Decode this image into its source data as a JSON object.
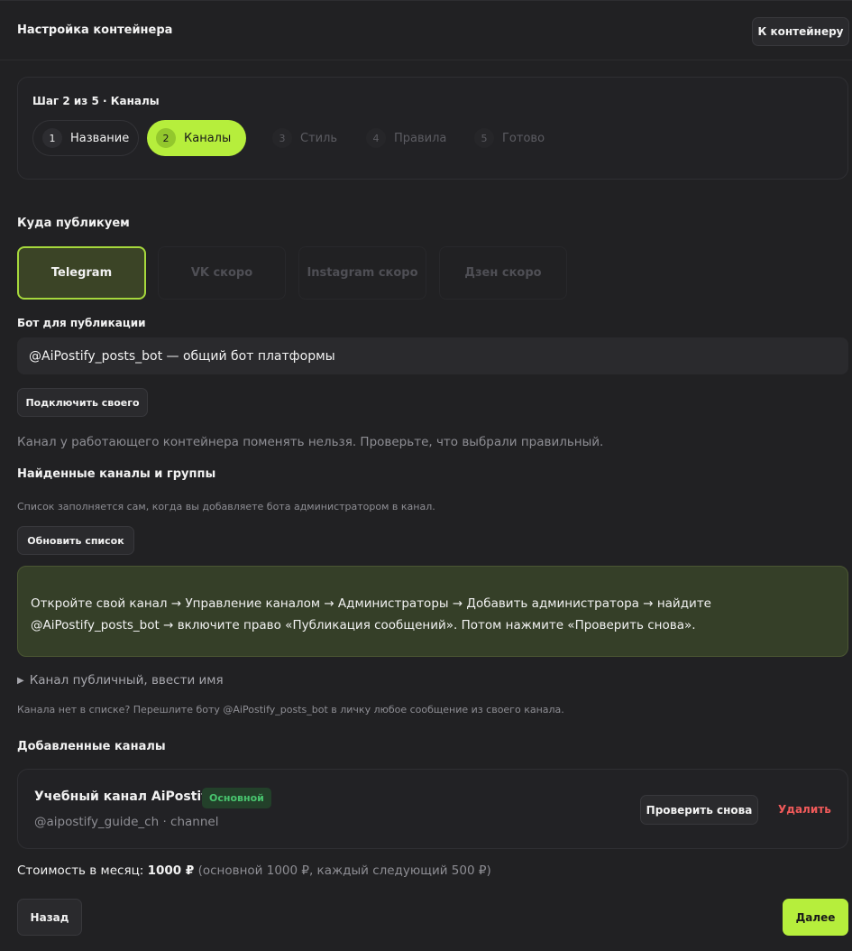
{
  "header": {
    "title": "Настройка контейнера",
    "to_container_label": "К контейнеру"
  },
  "stepper": {
    "caption": "Шаг 2 из 5 · Каналы",
    "steps": [
      {
        "num": "1",
        "label": "Название"
      },
      {
        "num": "2",
        "label": "Каналы"
      },
      {
        "num": "3",
        "label": "Стиль"
      },
      {
        "num": "4",
        "label": "Правила"
      },
      {
        "num": "5",
        "label": "Готово"
      }
    ]
  },
  "publish": {
    "title": "Куда публикуем",
    "platforms": [
      {
        "label": "Telegram"
      },
      {
        "label": "VK скоро"
      },
      {
        "label": "Instagram скоро"
      },
      {
        "label": "Дзен скоро"
      }
    ]
  },
  "bot": {
    "label": "Бот для публикации",
    "value": "@AiPostify_posts_bot — общий бот платформы",
    "connect_own_label": "Подключить своего",
    "warning": "Канал у работающего контейнера поменять нельзя. Проверьте, что выбрали правильный."
  },
  "found": {
    "title": "Найденные каналы и группы",
    "hint": "Список заполняется сам, когда вы добавляете бота администратором в канал.",
    "refresh_label": "Обновить список",
    "instructions": "Откройте свой канал → Управление каналом → Администраторы → Добавить администратора → найдите @AiPostify_posts_bot → включите право «Публикация сообщений». Потом нажмите «Проверить снова».",
    "public_toggle": "Канал публичный, ввести имя",
    "forward_hint": "Канала нет в списке? Перешлите боту @AiPostify_posts_bot в личку любое сообщение из своего канала."
  },
  "added": {
    "title": "Добавленные каналы",
    "channels": [
      {
        "name": "Учебный канал AiPostify",
        "badge": "Основной",
        "handle": "@aipostify_guide_ch · channel",
        "check_label": "Проверить снова",
        "delete_label": "Удалить"
      }
    ]
  },
  "price": {
    "label": "Стоимость в месяц:",
    "amount": "1000 ₽",
    "note": "(основной 1000 ₽, каждый следующий 500 ₽)"
  },
  "footer": {
    "back_label": "Назад",
    "next_label": "Далее"
  },
  "colors": {
    "accent": "#b6ee3c",
    "background": "#212123",
    "danger": "#f05a5a",
    "success": "#48c46e"
  }
}
